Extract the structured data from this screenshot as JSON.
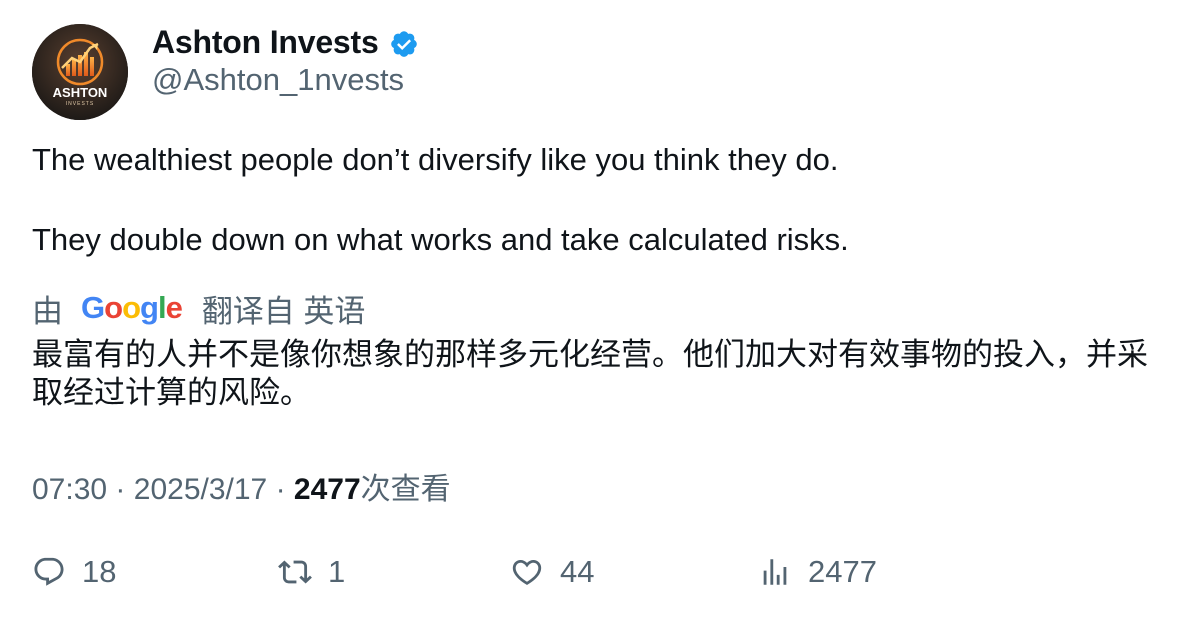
{
  "author": {
    "display_name": "Ashton Invests",
    "handle": "@Ashton_1nvests",
    "avatar_text": "ASHTON",
    "avatar_subtext": "INVESTS",
    "verified_icon": "verified-badge-icon",
    "verified_color": "#1d9bf0"
  },
  "tweet": {
    "paragraphs": [
      "The wealthiest people don’t diversify like you think they do.",
      "They double down on what works and take calculated risks."
    ]
  },
  "translation": {
    "by_label": "由",
    "google_letters": [
      "G",
      "o",
      "o",
      "g",
      "l",
      "e"
    ],
    "translated_from_label": "翻译自 英语",
    "text": "最富有的人并不是像你想象的那样多元化经营。他们加大对有效事物的投入，并采取经过计算的风险。"
  },
  "meta": {
    "time": "07:30",
    "separator": "·",
    "date": "2025/3/17",
    "views_count": "2477",
    "views_label": "次查看"
  },
  "actions": {
    "reply": {
      "icon": "reply-icon",
      "count": "18"
    },
    "retweet": {
      "icon": "retweet-icon",
      "count": "1"
    },
    "like": {
      "icon": "heart-icon",
      "count": "44"
    },
    "views": {
      "icon": "analytics-icon",
      "count": "2477"
    }
  },
  "colors": {
    "text_primary": "#0f1419",
    "text_secondary": "#536471",
    "accent": "#1d9bf0"
  }
}
